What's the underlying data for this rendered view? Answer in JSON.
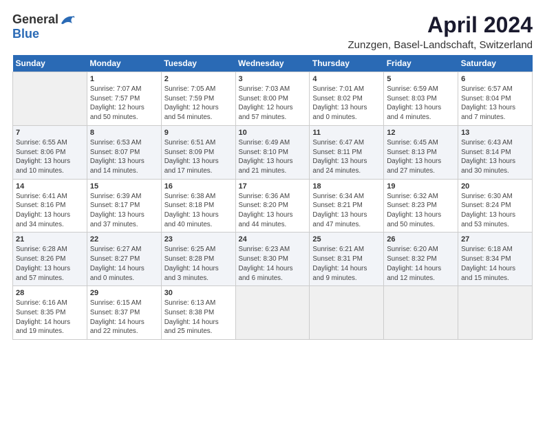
{
  "header": {
    "logo_general": "General",
    "logo_blue": "Blue",
    "title": "April 2024",
    "subtitle": "Zunzgen, Basel-Landschaft, Switzerland"
  },
  "columns": [
    "Sunday",
    "Monday",
    "Tuesday",
    "Wednesday",
    "Thursday",
    "Friday",
    "Saturday"
  ],
  "rows": [
    [
      {
        "day": "",
        "info": ""
      },
      {
        "day": "1",
        "info": "Sunrise: 7:07 AM\nSunset: 7:57 PM\nDaylight: 12 hours\nand 50 minutes."
      },
      {
        "day": "2",
        "info": "Sunrise: 7:05 AM\nSunset: 7:59 PM\nDaylight: 12 hours\nand 54 minutes."
      },
      {
        "day": "3",
        "info": "Sunrise: 7:03 AM\nSunset: 8:00 PM\nDaylight: 12 hours\nand 57 minutes."
      },
      {
        "day": "4",
        "info": "Sunrise: 7:01 AM\nSunset: 8:02 PM\nDaylight: 13 hours\nand 0 minutes."
      },
      {
        "day": "5",
        "info": "Sunrise: 6:59 AM\nSunset: 8:03 PM\nDaylight: 13 hours\nand 4 minutes."
      },
      {
        "day": "6",
        "info": "Sunrise: 6:57 AM\nSunset: 8:04 PM\nDaylight: 13 hours\nand 7 minutes."
      }
    ],
    [
      {
        "day": "7",
        "info": "Sunrise: 6:55 AM\nSunset: 8:06 PM\nDaylight: 13 hours\nand 10 minutes."
      },
      {
        "day": "8",
        "info": "Sunrise: 6:53 AM\nSunset: 8:07 PM\nDaylight: 13 hours\nand 14 minutes."
      },
      {
        "day": "9",
        "info": "Sunrise: 6:51 AM\nSunset: 8:09 PM\nDaylight: 13 hours\nand 17 minutes."
      },
      {
        "day": "10",
        "info": "Sunrise: 6:49 AM\nSunset: 8:10 PM\nDaylight: 13 hours\nand 21 minutes."
      },
      {
        "day": "11",
        "info": "Sunrise: 6:47 AM\nSunset: 8:11 PM\nDaylight: 13 hours\nand 24 minutes."
      },
      {
        "day": "12",
        "info": "Sunrise: 6:45 AM\nSunset: 8:13 PM\nDaylight: 13 hours\nand 27 minutes."
      },
      {
        "day": "13",
        "info": "Sunrise: 6:43 AM\nSunset: 8:14 PM\nDaylight: 13 hours\nand 30 minutes."
      }
    ],
    [
      {
        "day": "14",
        "info": "Sunrise: 6:41 AM\nSunset: 8:16 PM\nDaylight: 13 hours\nand 34 minutes."
      },
      {
        "day": "15",
        "info": "Sunrise: 6:39 AM\nSunset: 8:17 PM\nDaylight: 13 hours\nand 37 minutes."
      },
      {
        "day": "16",
        "info": "Sunrise: 6:38 AM\nSunset: 8:18 PM\nDaylight: 13 hours\nand 40 minutes."
      },
      {
        "day": "17",
        "info": "Sunrise: 6:36 AM\nSunset: 8:20 PM\nDaylight: 13 hours\nand 44 minutes."
      },
      {
        "day": "18",
        "info": "Sunrise: 6:34 AM\nSunset: 8:21 PM\nDaylight: 13 hours\nand 47 minutes."
      },
      {
        "day": "19",
        "info": "Sunrise: 6:32 AM\nSunset: 8:23 PM\nDaylight: 13 hours\nand 50 minutes."
      },
      {
        "day": "20",
        "info": "Sunrise: 6:30 AM\nSunset: 8:24 PM\nDaylight: 13 hours\nand 53 minutes."
      }
    ],
    [
      {
        "day": "21",
        "info": "Sunrise: 6:28 AM\nSunset: 8:26 PM\nDaylight: 13 hours\nand 57 minutes."
      },
      {
        "day": "22",
        "info": "Sunrise: 6:27 AM\nSunset: 8:27 PM\nDaylight: 14 hours\nand 0 minutes."
      },
      {
        "day": "23",
        "info": "Sunrise: 6:25 AM\nSunset: 8:28 PM\nDaylight: 14 hours\nand 3 minutes."
      },
      {
        "day": "24",
        "info": "Sunrise: 6:23 AM\nSunset: 8:30 PM\nDaylight: 14 hours\nand 6 minutes."
      },
      {
        "day": "25",
        "info": "Sunrise: 6:21 AM\nSunset: 8:31 PM\nDaylight: 14 hours\nand 9 minutes."
      },
      {
        "day": "26",
        "info": "Sunrise: 6:20 AM\nSunset: 8:32 PM\nDaylight: 14 hours\nand 12 minutes."
      },
      {
        "day": "27",
        "info": "Sunrise: 6:18 AM\nSunset: 8:34 PM\nDaylight: 14 hours\nand 15 minutes."
      }
    ],
    [
      {
        "day": "28",
        "info": "Sunrise: 6:16 AM\nSunset: 8:35 PM\nDaylight: 14 hours\nand 19 minutes."
      },
      {
        "day": "29",
        "info": "Sunrise: 6:15 AM\nSunset: 8:37 PM\nDaylight: 14 hours\nand 22 minutes."
      },
      {
        "day": "30",
        "info": "Sunrise: 6:13 AM\nSunset: 8:38 PM\nDaylight: 14 hours\nand 25 minutes."
      },
      {
        "day": "",
        "info": ""
      },
      {
        "day": "",
        "info": ""
      },
      {
        "day": "",
        "info": ""
      },
      {
        "day": "",
        "info": ""
      }
    ]
  ]
}
